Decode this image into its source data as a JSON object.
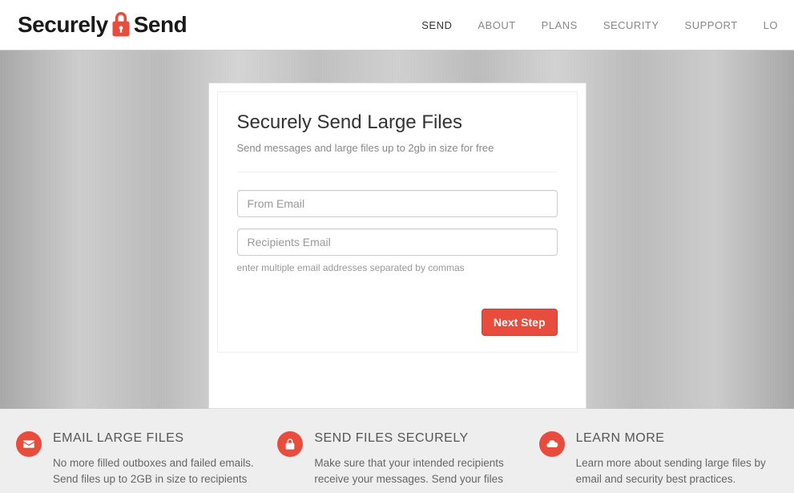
{
  "logo": {
    "part1": "Securely",
    "part2": "Send"
  },
  "nav": {
    "items": [
      {
        "label": "SEND",
        "active": true
      },
      {
        "label": "ABOUT",
        "active": false
      },
      {
        "label": "PLANS",
        "active": false
      },
      {
        "label": "SECURITY",
        "active": false
      },
      {
        "label": "SUPPORT",
        "active": false
      },
      {
        "label": "LO",
        "active": false
      }
    ]
  },
  "card": {
    "title": "Securely Send Large Files",
    "subtitle": "Send messages and large files up to 2gb in size for free",
    "from_placeholder": "From Email",
    "recipients_placeholder": "Recipients Email",
    "recipients_hint": "enter multiple email addresses separated by commas",
    "next_label": "Next Step"
  },
  "features": [
    {
      "icon": "envelope-icon",
      "title": "EMAIL LARGE FILES",
      "text": "No more filled outboxes and failed emails. Send files up to 2GB in size to recipients"
    },
    {
      "icon": "lock-icon",
      "title": "SEND FILES SECURELY",
      "text": "Make sure that your intended recipients receive your messages. Send your files"
    },
    {
      "icon": "cloud-icon",
      "title": "LEARN MORE",
      "text": "Learn more about sending large files by email and security best practices."
    }
  ],
  "colors": {
    "accent": "#e74c3c"
  }
}
